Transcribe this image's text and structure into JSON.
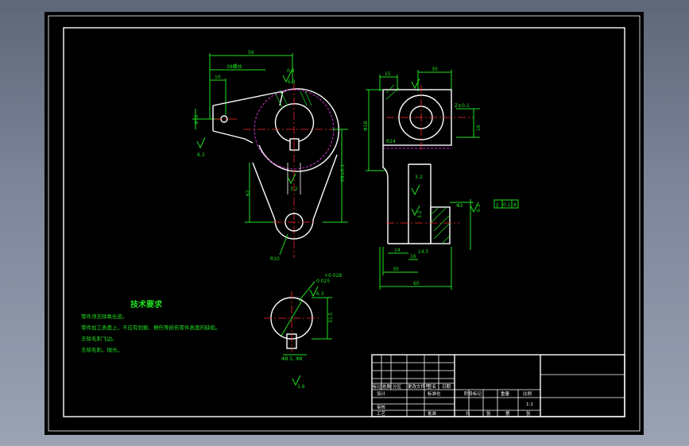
{
  "technical_requirements": {
    "title": "技术要求",
    "items": [
      "零件须去除氧化皮。",
      "零件加工表面上，不应有划痕、擦伤等损伤零件表面的缺陷。",
      "去除毛刺飞边。",
      "去除毛刺，抛光。"
    ]
  },
  "front_view": {
    "dim_top_overall": "56",
    "dim_top_partial": "38螺纹",
    "dim_left_small": "10",
    "dim_left_vertical": "Φ10",
    "dim_height_right": "69±0.1",
    "dim_height_left": "62",
    "dim_radius_bottom": "R10",
    "rough_top": "6.3",
    "rough_top_prefix": "0.8",
    "rough_left": "6.3",
    "rough_center": "3.2"
  },
  "side_view": {
    "dim_top_left": "15",
    "dim_top_right": "30",
    "dim_width_bottom": "60",
    "dim_bottom_30": "30",
    "dim_bottom_16": "16",
    "dim_bottom_14": "14",
    "dim_height_left": "Φ18",
    "dim_right_16": "16",
    "dim_right_tol": "Z±0.1",
    "dim_bottom_ext": "14.5",
    "label_r24": "R24",
    "rough_center": "3.2",
    "rough_bottom": "3.2",
    "rough_right": "6.3",
    "dim_phi": "Φ2",
    "gdt_frame": [
      "∥",
      "0.1",
      "A"
    ]
  },
  "section_view": {
    "rough_top": "6.3",
    "tol_top": "0.025",
    "tol_top_prefix": "+0.028",
    "dim_right": "31.5",
    "dim_bottom": "Φ8.5, Φ8",
    "rough_bottom": "1.6"
  },
  "title_block": {
    "row_labels": [
      "标记",
      "处数",
      "分区",
      "更改文件号",
      "签名",
      "日期"
    ],
    "design_row": [
      "设计",
      "标准化"
    ],
    "stage_labels": [
      "阶段标记",
      "重量",
      "比例"
    ],
    "scale": "1:1",
    "review_row": [
      "审核"
    ],
    "process_row": [
      "工艺",
      "批准"
    ],
    "sheet_row": [
      "共",
      "张",
      "第",
      "张"
    ]
  }
}
